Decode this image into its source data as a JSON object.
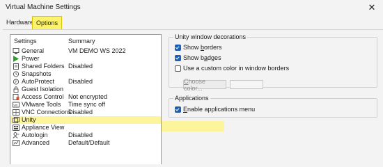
{
  "window": {
    "title": "Virtual Machine Settings",
    "close_glyph": "✕"
  },
  "tabs": [
    {
      "label": "Hardware",
      "selected": false
    },
    {
      "label": "Options",
      "selected": true
    }
  ],
  "settings_list": {
    "headers": {
      "settings": "Settings",
      "summary": "Summary"
    },
    "items": [
      {
        "name": "General",
        "summary": "VM DEMO WS 2022",
        "icon": "general-icon"
      },
      {
        "name": "Power",
        "summary": "",
        "icon": "power-icon"
      },
      {
        "name": "Shared Folders",
        "summary": "Disabled",
        "icon": "shared-folders-icon"
      },
      {
        "name": "Snapshots",
        "summary": "",
        "icon": "snapshots-icon"
      },
      {
        "name": "AutoProtect",
        "summary": "Disabled",
        "icon": "autoprotect-icon"
      },
      {
        "name": "Guest Isolation",
        "summary": "",
        "icon": "guest-isolation-icon"
      },
      {
        "name": "Access Control",
        "summary": "Not encrypted",
        "icon": "access-control-icon"
      },
      {
        "name": "VMware Tools",
        "summary": "Time sync off",
        "icon": "vmware-tools-icon"
      },
      {
        "name": "VNC Connections",
        "summary": "Disabled",
        "icon": "vnc-connections-icon"
      },
      {
        "name": "Unity",
        "summary": "",
        "icon": "unity-icon",
        "selected": true
      },
      {
        "name": "Appliance View",
        "summary": "",
        "icon": "appliance-view-icon"
      },
      {
        "name": "Autologin",
        "summary": "Disabled",
        "icon": "autologin-icon"
      },
      {
        "name": "Advanced",
        "summary": "Default/Default",
        "icon": "advanced-icon"
      }
    ]
  },
  "unity_decorations": {
    "title": "Unity window decorations",
    "show_borders": {
      "pre": "Show ",
      "accel": "b",
      "post": "orders",
      "checked": true
    },
    "show_badges": {
      "pre": "Show b",
      "accel": "a",
      "post": "dges",
      "checked": true
    },
    "custom_color": {
      "label": "Use a custom color in window borders",
      "checked": false
    },
    "choose_color": {
      "accel": "C",
      "post": "hoose color..."
    }
  },
  "applications": {
    "title": "Applications",
    "enable_menu": {
      "accel": "E",
      "post": "nable applications menu",
      "checked": true
    }
  },
  "colors": {
    "selection": "#fdf59c",
    "tab_highlight": "#fdf26b",
    "accent": "#1a5fb4"
  }
}
